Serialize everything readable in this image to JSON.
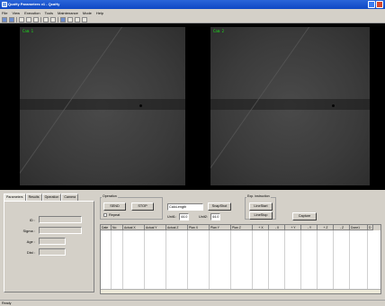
{
  "window": {
    "title": "QcaHy Parameters v1 - QcaHy",
    "icon": "app-icon"
  },
  "menu": [
    "File",
    "View",
    "Execution",
    "Tools",
    "Maintenance",
    "Mode",
    "Help"
  ],
  "cameras": [
    {
      "label": "Cam 1"
    },
    {
      "label": "Cam 2"
    }
  ],
  "tabs": [
    "Parameters",
    "Results",
    "Operation",
    "Camera"
  ],
  "params_fields": [
    {
      "label": "ID :"
    },
    {
      "label": "Sigma :"
    },
    {
      "label": "Age :"
    },
    {
      "label": "Dist :"
    }
  ],
  "operation": {
    "title": "Operation",
    "send_label": "SEND",
    "stop_label": "STOP",
    "repeat_label": "Repeat",
    "calc_value": "CalcLength",
    "snapshot_label": "SnapShot",
    "unit1_label": "Unit1:",
    "unit1_value": "44.0",
    "unit2_label": "Unit2:",
    "unit2_value": "44.0"
  },
  "exp": {
    "title": "Exp. instruction",
    "linestart_label": "LineStart",
    "linestop_label": "LineStop",
    "capture_label": "Capture"
  },
  "grid_columns": [
    "Date",
    "No",
    "Actual X",
    "Actual Y",
    "Actual Z",
    "Plan X",
    "Plan Y",
    "Plan Z",
    "+ X",
    "- X",
    "+ Y",
    "- Y",
    "+ Z",
    "- Z",
    "Done1",
    "D"
  ],
  "status": "Ready"
}
